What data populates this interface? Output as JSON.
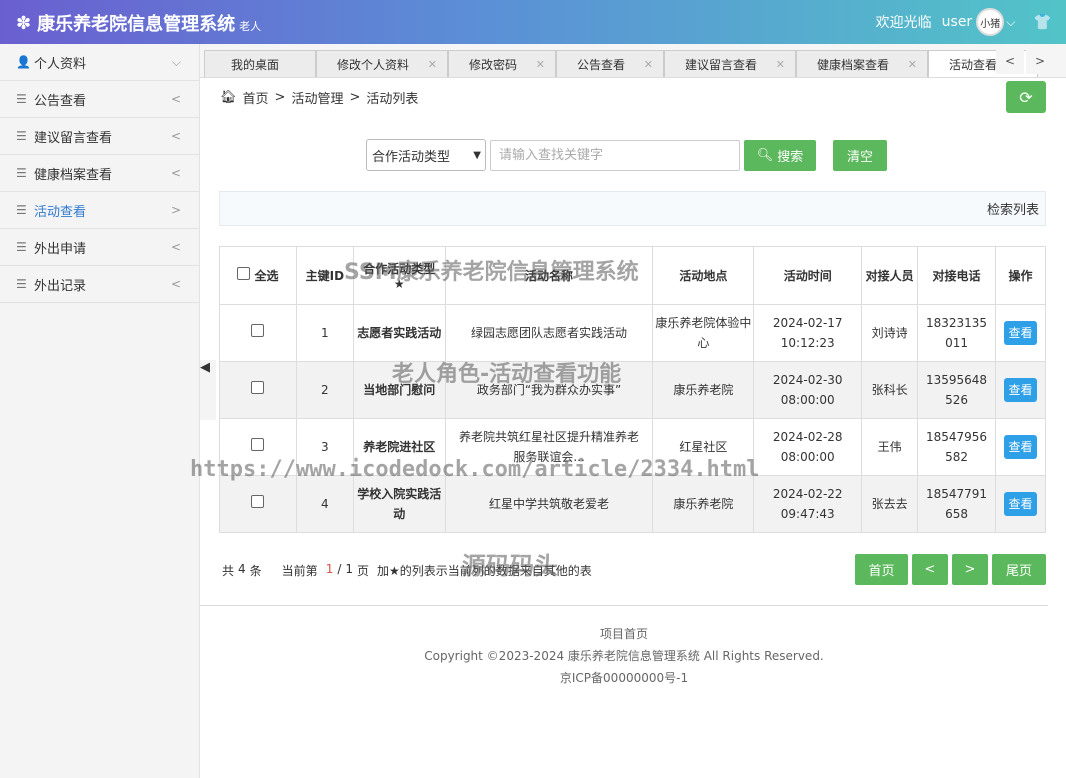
{
  "header": {
    "app_title": "康乐养老院信息管理系统",
    "role": "老人",
    "welcome": "欢迎光临",
    "user": "user",
    "avatar_text": "小猪"
  },
  "sidebar": {
    "items": [
      {
        "label": "个人资料",
        "icon": "person-icon",
        "arrow": "⌵"
      },
      {
        "label": "公告查看",
        "icon": "list-icon",
        "arrow": "<"
      },
      {
        "label": "建议留言查看",
        "icon": "list-icon",
        "arrow": "<"
      },
      {
        "label": "健康档案查看",
        "icon": "list-icon",
        "arrow": "<"
      },
      {
        "label": "活动查看",
        "icon": "list-icon",
        "arrow": ">"
      },
      {
        "label": "外出申请",
        "icon": "list-icon",
        "arrow": "<"
      },
      {
        "label": "外出记录",
        "icon": "list-icon",
        "arrow": "<"
      }
    ]
  },
  "tabs": [
    {
      "label": "我的桌面"
    },
    {
      "label": "修改个人资料"
    },
    {
      "label": "修改密码"
    },
    {
      "label": "公告查看"
    },
    {
      "label": "建议留言查看"
    },
    {
      "label": "健康档案查看"
    },
    {
      "label": "活动查看"
    }
  ],
  "breadcrumb": {
    "home": "首页",
    "sep": ">",
    "level1": "活动管理",
    "level2": "活动列表"
  },
  "search": {
    "select_value": "合作活动类型",
    "placeholder": "请输入查找关键字",
    "search_label": "搜索",
    "clear_label": "清空"
  },
  "panel_title": "检索列表",
  "table": {
    "headers": {
      "select_all": "全选",
      "id": "主键ID",
      "type": "合作活动类型",
      "name": "活动名称",
      "place": "活动地点",
      "time": "活动时间",
      "contact": "对接人员",
      "phone": "对接电话",
      "op": "操作"
    },
    "rows": [
      {
        "id": "1",
        "type": "志愿者实践活动",
        "name": "绿园志愿团队志愿者实践活动",
        "place": "康乐养老院体验中心",
        "time": "2024-02-17 10:12:23",
        "contact": "刘诗诗",
        "phone": "18323135011",
        "op": "查看"
      },
      {
        "id": "2",
        "type": "当地部门慰问",
        "name": "政务部门“我为群众办实事”",
        "place": "康乐养老院",
        "time": "2024-02-30 08:00:00",
        "contact": "张科长",
        "phone": "13595648526",
        "op": "查看"
      },
      {
        "id": "3",
        "type": "养老院进社区",
        "name": "养老院共筑红星社区提升精准养老服务联谊会...",
        "place": "红星社区",
        "time": "2024-02-28 08:00:00",
        "contact": "王伟",
        "phone": "18547956582",
        "op": "查看"
      },
      {
        "id": "4",
        "type": "学校入院实践活动",
        "name": "红星中学共筑敬老爱老",
        "place": "康乐养老院",
        "time": "2024-02-22 09:47:43",
        "contact": "张去去",
        "phone": "18547791658",
        "op": "查看"
      }
    ]
  },
  "pager": {
    "total_prefix": "共",
    "total": "4",
    "total_suffix": "条",
    "current_prefix": "当前第",
    "current": "1",
    "sep": "/",
    "pages": "1",
    "page_suffix": "页",
    "note": "加★的列表示当前列的数据来自其他的表",
    "first": "首页",
    "prev": "<",
    "next": ">",
    "last": "尾页"
  },
  "footer": {
    "home": "项目首页",
    "copyright": "Copyright ©2023-2024 康乐养老院信息管理系统 All Rights Reserved.",
    "icp": "京ICP备00000000号-1"
  },
  "watermarks": {
    "w1": "SSM康乐养老院信息管理系统",
    "w2": "老人角色-活动查看功能",
    "w3": "https://www.icodedock.com/article/2334.html",
    "w4": "源码码头"
  },
  "colors": {
    "accent_green": "#5cb85c",
    "header_start": "#6a5fd0",
    "header_end": "#52c4c8",
    "type_red": "#b0272a",
    "view_blue": "#2ea0e8"
  }
}
